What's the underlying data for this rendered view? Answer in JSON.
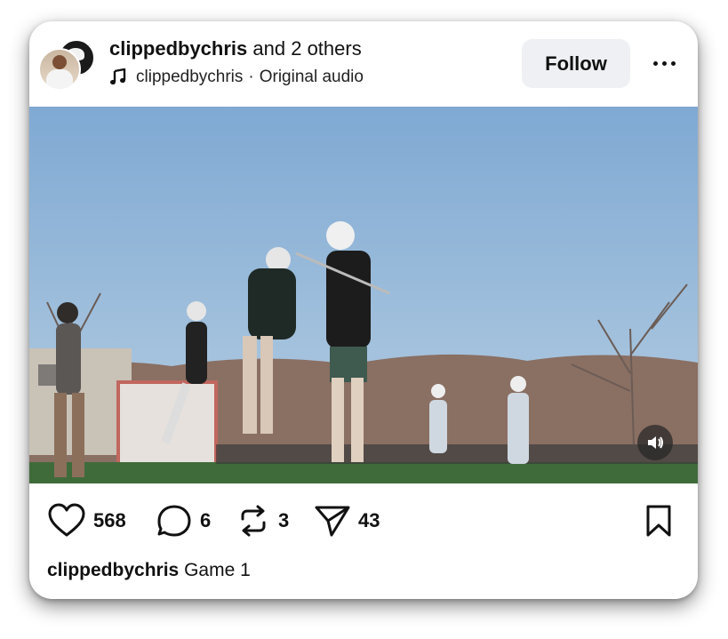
{
  "post": {
    "author": "clippedbychris",
    "coauthors_text": "and 2 others",
    "audio_user": "clippedbychris",
    "audio_separator": "·",
    "audio_title": "Original audio",
    "follow_label": "Follow",
    "icons": {
      "music": "music-note-icon",
      "more": "more-dots-icon",
      "sound": "speaker-icon",
      "like": "heart-icon",
      "comment": "comment-bubble-icon",
      "repost": "repost-arrows-icon",
      "share": "send-paper-plane-icon",
      "save": "bookmark-icon"
    }
  },
  "stats": {
    "likes": "568",
    "comments": "6",
    "reposts": "3",
    "shares": "43"
  },
  "caption": {
    "user": "clippedbychris",
    "text": "Game 1"
  },
  "colors": {
    "follow_bg": "#eef0f3",
    "text": "#111111",
    "sky": "#8fb4d4",
    "turf": "#3f6b3a"
  }
}
